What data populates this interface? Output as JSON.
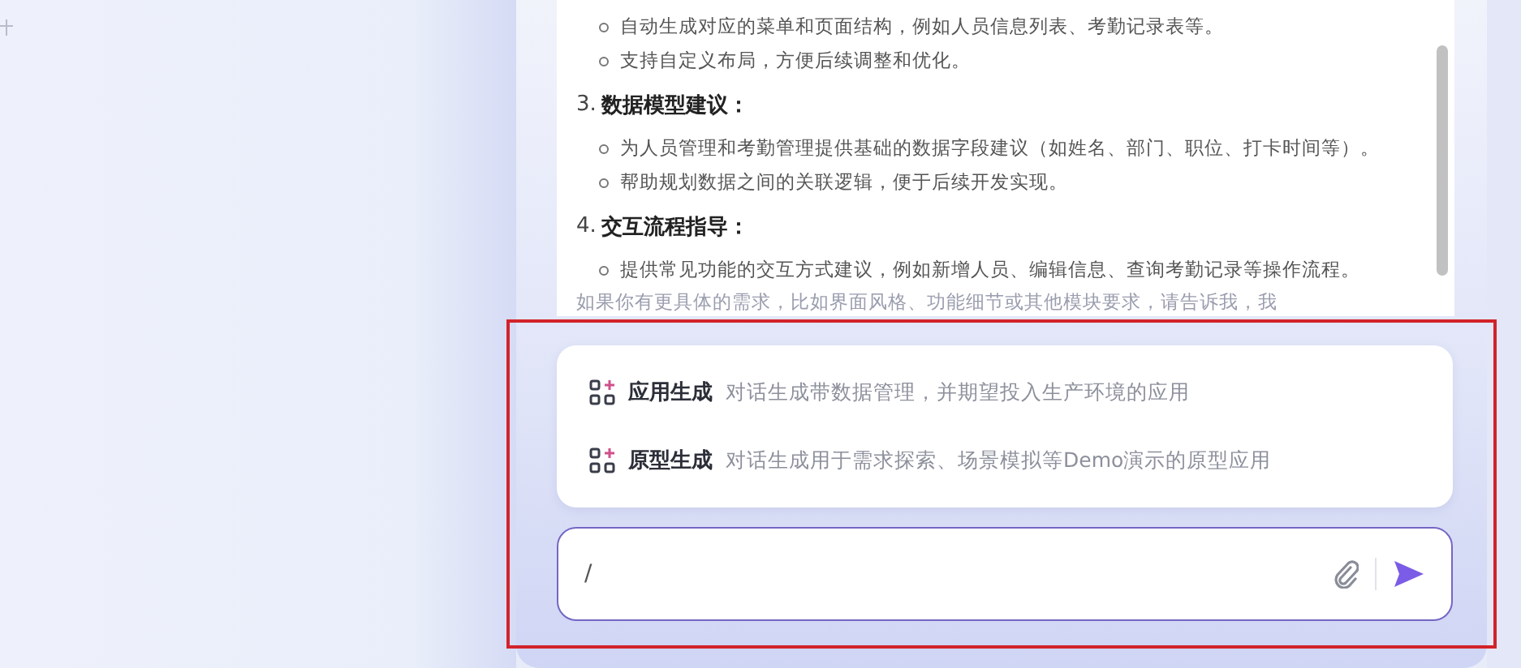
{
  "message": {
    "blocks": [
      {
        "kind": "bullet",
        "text": "自动生成对应的菜单和页面结构，例如人员信息列表、考勤记录表等。"
      },
      {
        "kind": "bullet",
        "text": "支持自定义布局，方便后续调整和优化。"
      },
      {
        "kind": "heading",
        "number": "3.",
        "text": "数据模型建议："
      },
      {
        "kind": "bullet",
        "text": "为人员管理和考勤管理提供基础的数据字段建议（如姓名、部门、职位、打卡时间等）。"
      },
      {
        "kind": "bullet",
        "text": "帮助规划数据之间的关联逻辑，便于后续开发实现。"
      },
      {
        "kind": "heading",
        "number": "4.",
        "text": "交互流程指导："
      },
      {
        "kind": "bullet",
        "text": "提供常见功能的交互方式建议，例如新增人员、编辑信息、查询考勤记录等操作流程。"
      },
      {
        "kind": "faded",
        "text": "如果你有更具体的需求，比如界面风格、功能细节或其他模块要求，请告诉我，我"
      }
    ]
  },
  "suggestions": [
    {
      "title": "应用生成",
      "description": "对话生成带数据管理，并期望投入生产环境的应用"
    },
    {
      "title": "原型生成",
      "description": "对话生成用于需求探索、场景模拟等Demo演示的原型应用"
    }
  ],
  "input": {
    "value": "/"
  }
}
